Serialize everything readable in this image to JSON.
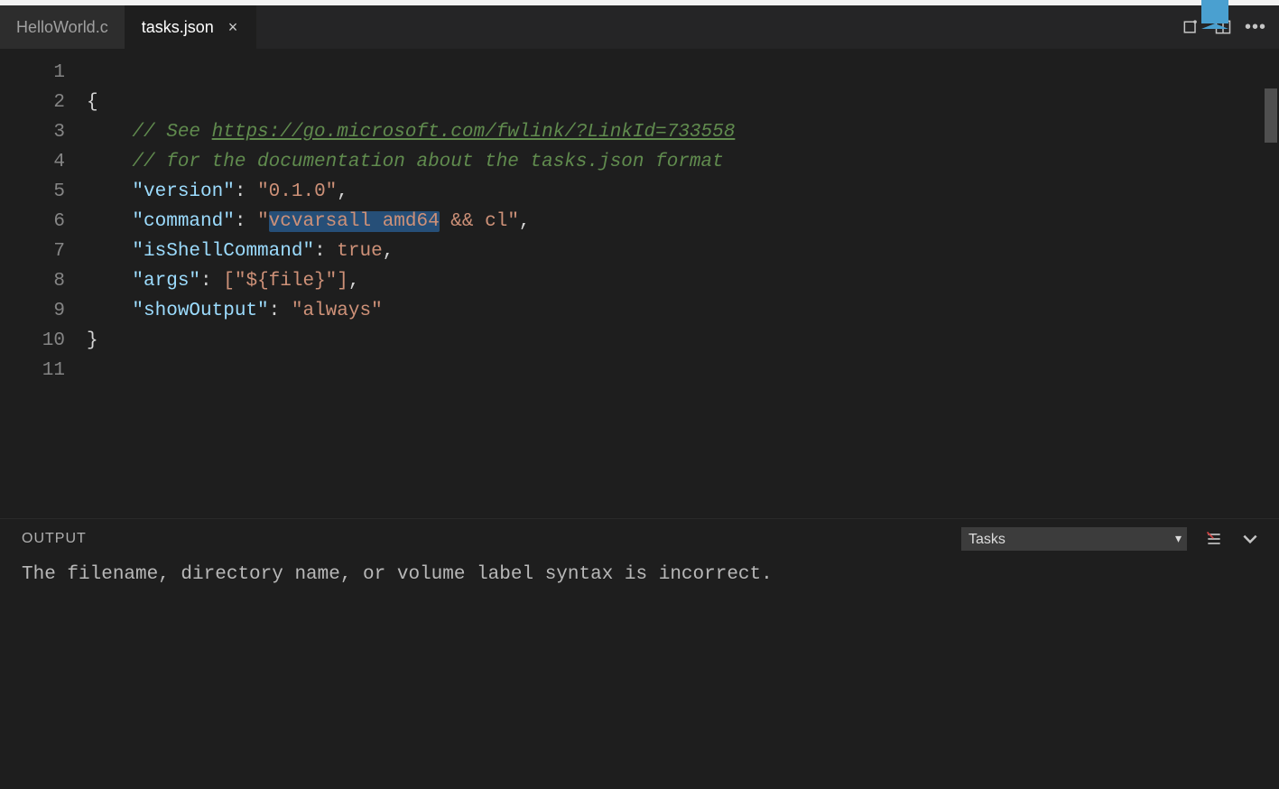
{
  "tabs": [
    {
      "label": "HelloWorld.c",
      "active": false
    },
    {
      "label": "tasks.json",
      "active": true
    }
  ],
  "editor": {
    "line_count": 11,
    "selection": {
      "line": 5,
      "text": "vcvarsall amd64"
    },
    "code": {
      "comment_url": "https://go.microsoft.com/fwlink/?LinkId=733558",
      "comment_prefix": "// See ",
      "comment_line2": "// for the documentation about the tasks.json format",
      "version_key": "\"version\"",
      "version_val": "\"0.1.0\"",
      "command_key": "\"command\"",
      "command_val_pre": "\"",
      "command_val_sel": "vcvarsall amd64",
      "command_val_post": " && cl\"",
      "isshell_key": "\"isShellCommand\"",
      "isshell_val": "true",
      "args_key": "\"args\"",
      "args_val": "[\"${file}\"]",
      "showout_key": "\"showOutput\"",
      "showout_val": "\"always\"",
      "brace_open": "{",
      "brace_close": "}"
    }
  },
  "panel": {
    "title": "OUTPUT",
    "select": "Tasks",
    "message": "The filename, directory name, or volume label syntax is incorrect."
  }
}
